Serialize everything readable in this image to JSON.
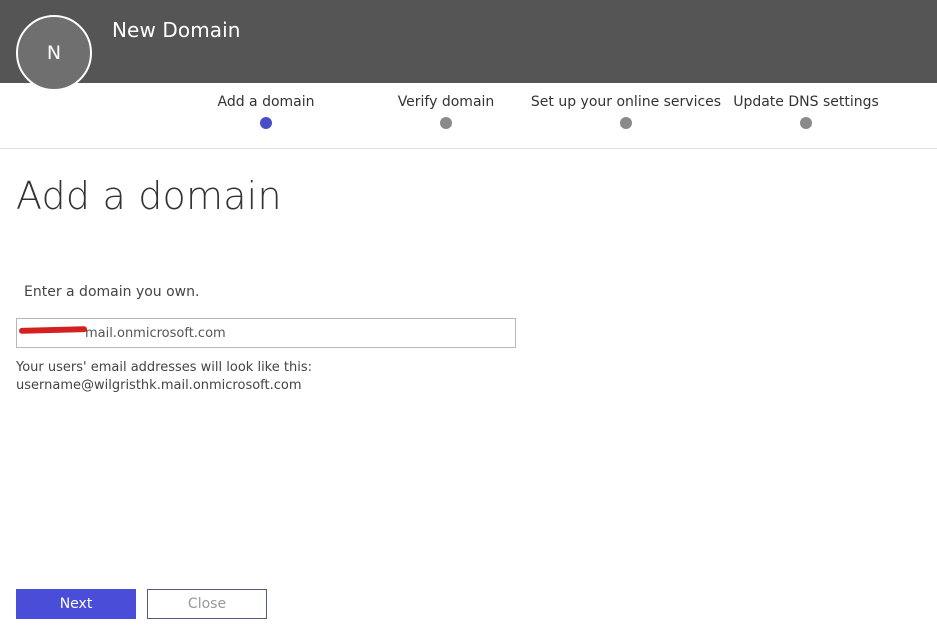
{
  "header": {
    "avatar_initial": "N",
    "title": "New Domain",
    "background_color": "#555555"
  },
  "wizard": {
    "steps": [
      {
        "label": "Add a domain",
        "state": "active"
      },
      {
        "label": "Verify domain",
        "state": "inactive"
      },
      {
        "label": "Set up your online services",
        "state": "inactive"
      },
      {
        "label": "Update DNS settings",
        "state": "inactive"
      }
    ],
    "active_color": "#4a4dc8",
    "inactive_color": "#8a8a8a"
  },
  "main": {
    "title": "Add a domain",
    "instruction": "Enter a domain you own.",
    "domain_input": {
      "value": "mail.onmicrosoft.com",
      "redacted_prefix": true
    },
    "help_text": {
      "line1": "Your users' email addresses will look like this:",
      "line2": "username@wilgristhk.mail.onmicrosoft.com"
    }
  },
  "footer": {
    "next_label": "Next",
    "close_label": "Close",
    "primary_color": "#4a4dd8"
  }
}
